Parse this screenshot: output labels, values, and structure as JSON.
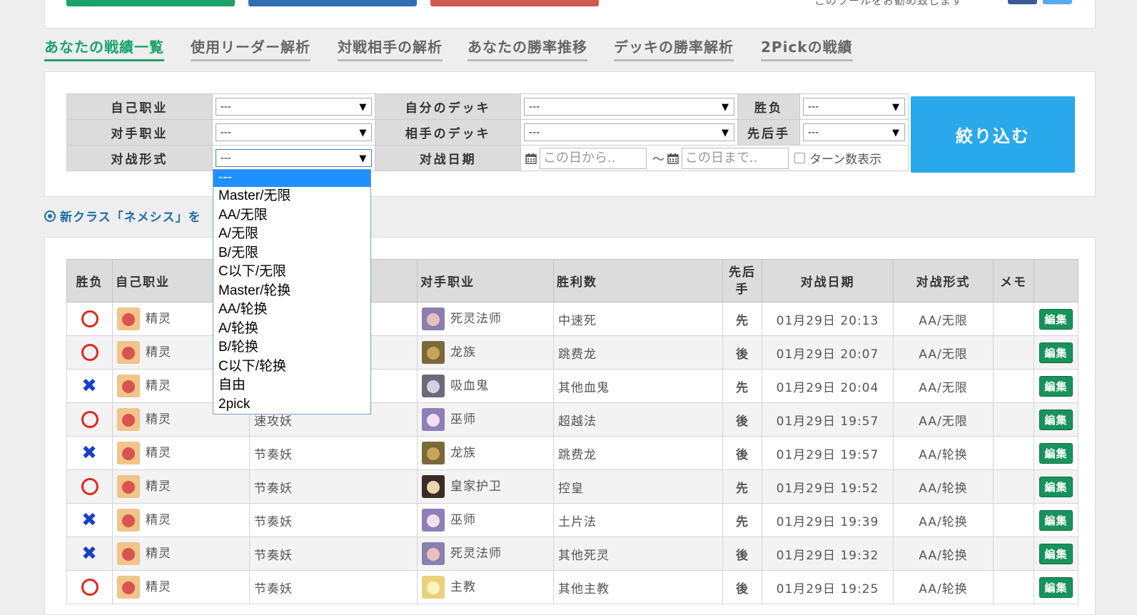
{
  "header": {
    "top_text": "このツールをお勧め致します",
    "colors": {
      "green": "#1aa36b",
      "blue": "#2f6faf",
      "red": "#cf5b4f",
      "facebook": "#3b5998",
      "twitter": "#55acee"
    }
  },
  "tabs": [
    {
      "label": "あなたの戦績一覧",
      "active": true
    },
    {
      "label": "使用リーダー解析"
    },
    {
      "label": "対戦相手の解析"
    },
    {
      "label": "あなたの勝率推移"
    },
    {
      "label": "デッキの勝率解析"
    },
    {
      "label": "2Pickの戦績"
    }
  ],
  "filters": {
    "self_class_label": "自己职业",
    "opponent_class_label": "对手职业",
    "format_label": "对战形式",
    "my_deck_label": "自分のデッキ",
    "opp_deck_label": "相手のデッキ",
    "date_label": "对战日期",
    "result_label": "胜负",
    "turn_order_label": "先后手",
    "select_default": "---",
    "date_from_placeholder": "この日から..",
    "date_to_placeholder": "この日まで..",
    "date_separator": "～",
    "turn_count_label": "ターン数表示",
    "submit_label": "絞り込む"
  },
  "notice": "新クラス「ネメシス」を",
  "format_options": [
    "---",
    "Master/无限",
    "AA/无限",
    "A/无限",
    "B/无限",
    "C以下/无限",
    "Master/轮换",
    "AA/轮换",
    "A/轮换",
    "B/轮换",
    "C以下/轮换",
    "自由",
    "2pick"
  ],
  "columns": [
    "胜负",
    "自己职业",
    "",
    "对手职业",
    "胜利数",
    "先后手",
    "对战日期",
    "对战形式",
    "メモ",
    ""
  ],
  "columns_turn": [
    "先后",
    "手"
  ],
  "rows": [
    {
      "result": "win",
      "self": "精灵",
      "deck": "",
      "opp": "死灵法师",
      "opp_deck": "中速死",
      "turn": "先",
      "date": "01月29日 20:13",
      "format": "AA/无限",
      "memo": "",
      "edit": "編集"
    },
    {
      "result": "win",
      "self": "精灵",
      "deck": "",
      "opp": "龙族",
      "opp_deck": "跳费龙",
      "turn": "後",
      "date": "01月29日 20:07",
      "format": "AA/无限",
      "memo": "",
      "edit": "編集"
    },
    {
      "result": "lose",
      "self": "精灵",
      "deck": "",
      "opp": "吸血鬼",
      "opp_deck": "其他血鬼",
      "turn": "先",
      "date": "01月29日 20:04",
      "format": "AA/无限",
      "memo": "",
      "edit": "編集"
    },
    {
      "result": "win",
      "self": "精灵",
      "deck": "速攻妖",
      "opp": "巫师",
      "opp_deck": "超越法",
      "turn": "後",
      "date": "01月29日 19:57",
      "format": "AA/无限",
      "memo": "",
      "edit": "編集"
    },
    {
      "result": "lose",
      "self": "精灵",
      "deck": "节奏妖",
      "opp": "龙族",
      "opp_deck": "跳费龙",
      "turn": "後",
      "date": "01月29日 19:57",
      "format": "AA/轮换",
      "memo": "",
      "edit": "編集"
    },
    {
      "result": "win",
      "self": "精灵",
      "deck": "节奏妖",
      "opp": "皇家护卫",
      "opp_deck": "控皇",
      "turn": "先",
      "date": "01月29日 19:52",
      "format": "AA/轮换",
      "memo": "",
      "edit": "編集"
    },
    {
      "result": "lose",
      "self": "精灵",
      "deck": "节奏妖",
      "opp": "巫师",
      "opp_deck": "土片法",
      "turn": "先",
      "date": "01月29日 19:39",
      "format": "AA/轮换",
      "memo": "",
      "edit": "編集"
    },
    {
      "result": "lose",
      "self": "精灵",
      "deck": "节奏妖",
      "opp": "死灵法师",
      "opp_deck": "其他死灵",
      "turn": "後",
      "date": "01月29日 19:32",
      "format": "AA/轮换",
      "memo": "",
      "edit": "編集"
    },
    {
      "result": "win",
      "self": "精灵",
      "deck": "节奏妖",
      "opp": "主教",
      "opp_deck": "其他主教",
      "turn": "後",
      "date": "01月29日 19:25",
      "format": "AA/轮换",
      "memo": "",
      "edit": "編集"
    }
  ]
}
